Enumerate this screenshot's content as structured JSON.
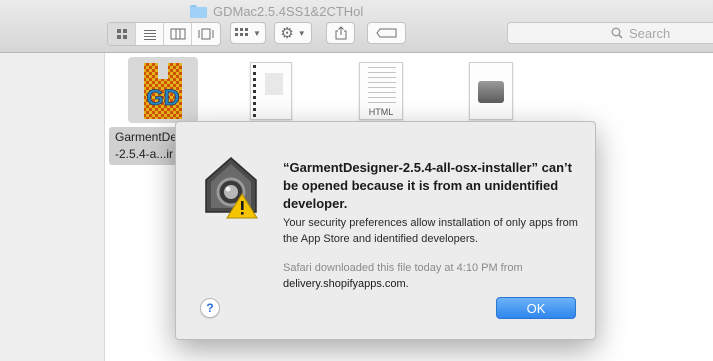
{
  "window": {
    "title": "GDMac2.5.4SS1&2CTHol"
  },
  "toolbar": {
    "view_buttons": [
      "icon-view",
      "list-view",
      "column-view",
      "cover-flow-view"
    ],
    "arrange_icon": "grid-icon",
    "action_icon": "gear-icon",
    "share_icon": "share-icon",
    "tag_icon": "tag-icon",
    "search_placeholder": "Search"
  },
  "files": [
    {
      "name_line1": "GarmentDe",
      "name_line2": "-2.5.4-a...ir",
      "icon": "garment-designer-app-icon"
    },
    {
      "name": "",
      "icon": "manual-doc-icon"
    },
    {
      "name": "",
      "icon": "html-doc-icon",
      "badge": "HTML"
    },
    {
      "name": "",
      "icon": "disk-image-icon"
    }
  ],
  "dialog": {
    "title": "“GarmentDesigner-2.5.4-all-osx-installer” can’t be opened because it is from an unidentified developer.",
    "message": "Your security preferences allow installation of only apps from the App Store and identified developers.",
    "note": "Safari downloaded this file today at 4:10 PM from",
    "source": "delivery.shopifyapps.com.",
    "help_label": "?",
    "ok_label": "OK",
    "icon": "gatekeeper-warning-icon"
  },
  "colors": {
    "accent": "#2f86ee",
    "warning": "#f5c400"
  }
}
